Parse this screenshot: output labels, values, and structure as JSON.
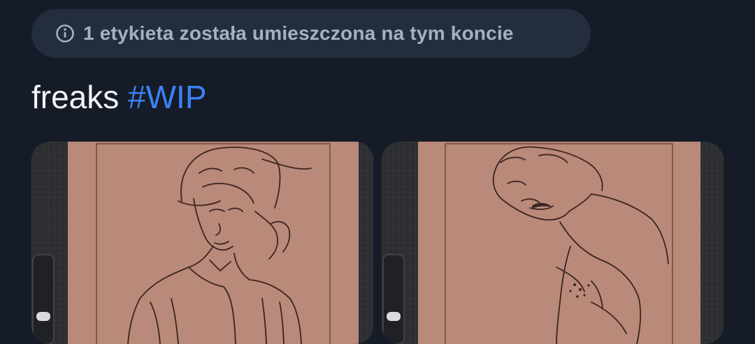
{
  "label_notice": {
    "icon": "info-icon",
    "text": "1 etykieta została umieszczona na tym koncie"
  },
  "post": {
    "text": "freaks",
    "hashtag": "#WIP"
  },
  "media": [
    {
      "name": "sketch-cowboy"
    },
    {
      "name": "sketch-shirtless-man"
    }
  ],
  "colors": {
    "background": "#151c27",
    "pill": "#232d3d",
    "hashtag": "#3b82f6",
    "paper": "#b9897a"
  }
}
